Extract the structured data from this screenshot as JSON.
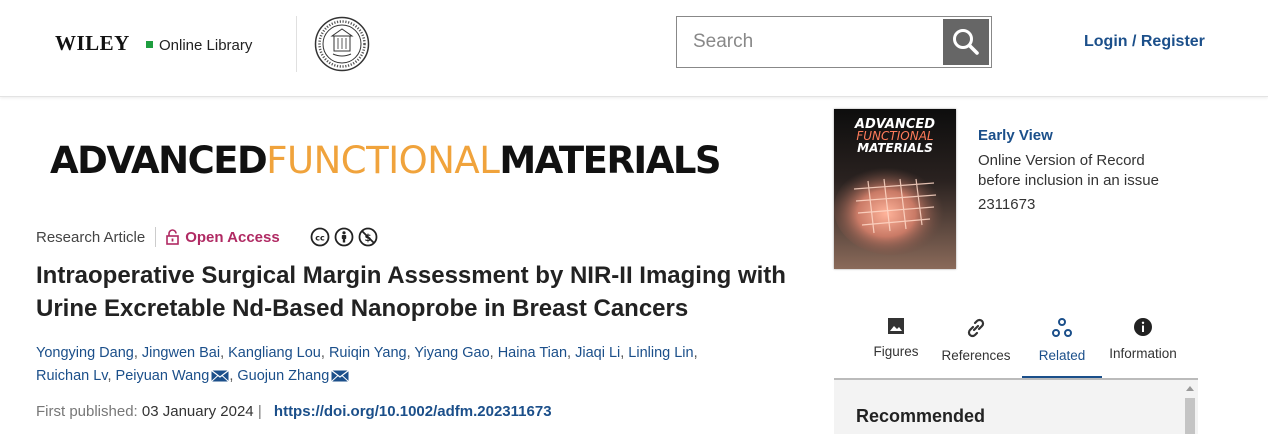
{
  "header": {
    "brand": "WILEY",
    "brand_sub": "Online Library",
    "search_placeholder": "Search",
    "login": "Login / Register"
  },
  "journal": {
    "name_part1": "ADVANCED",
    "name_part2": "FUNCTIONAL",
    "name_part3": "MATERIALS"
  },
  "article": {
    "type": "Research Article",
    "access": "Open Access",
    "title": "Intraoperative Surgical Margin Assessment by NIR-II Imaging with Urine Excretable Nd-Based Nanoprobe in Breast Cancers",
    "authors": [
      "Yongying Dang",
      "Jingwen Bai",
      "Kangliang Lou",
      "Ruiqin Yang",
      "Yiyang Gao",
      "Haina Tian",
      "Jiaqi Li",
      "Linling Lin",
      "Ruichan Lv",
      "Peiyuan Wang",
      "Guojun Zhang"
    ],
    "first_published_label": "First published:",
    "first_published_date": "03 January 2024",
    "separator": "|",
    "doi": "https://doi.org/10.1002/adfm.202311673"
  },
  "issue": {
    "cover_title_1": "ADVANCED",
    "cover_title_2": "FUNCTIONAL",
    "cover_title_3": "MATERIALS",
    "status": "Early View",
    "description": "Online Version of Record before inclusion in an issue",
    "number": "2311673"
  },
  "tabs": [
    {
      "label": "Figures",
      "icon": "image-icon"
    },
    {
      "label": "References",
      "icon": "link-icon"
    },
    {
      "label": "Related",
      "icon": "related-icon",
      "active": true
    },
    {
      "label": "Information",
      "icon": "info-icon"
    }
  ],
  "recommended": {
    "title": "Recommended"
  },
  "colors": {
    "link": "#1b4f8a",
    "open_access": "#b02a63",
    "brand_green": "#1e9e3f",
    "journal_orange": "#f0a33c"
  }
}
